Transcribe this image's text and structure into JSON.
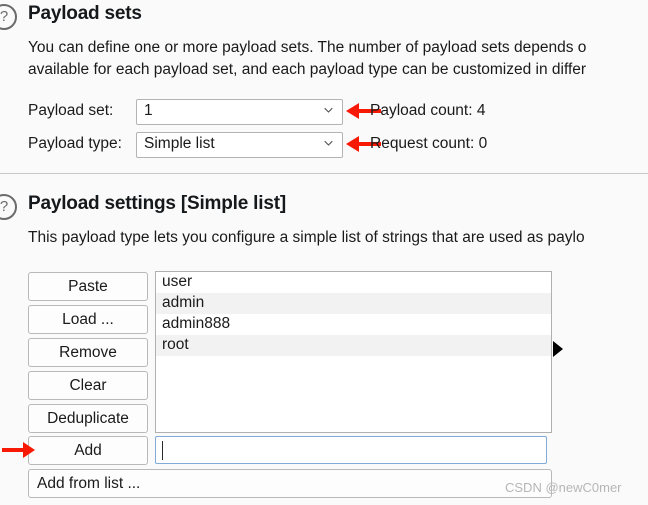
{
  "sections": [
    {
      "help_icon": "question-mark-icon",
      "title": "Payload sets",
      "desc_line1": "You can define one or more payload sets. The number of payload sets depends o",
      "desc_line2": "available for each payload set, and each payload type can be customized in differ"
    },
    {
      "help_icon": "question-mark-icon",
      "title": "Payload settings [Simple list]",
      "desc_line1": "This payload type lets you configure a simple list of strings that are used as paylo"
    }
  ],
  "payload_set": {
    "label": "Payload set:",
    "value": "1",
    "count_label": "Payload count: 4"
  },
  "payload_type": {
    "label": "Payload type:",
    "value": "Simple list",
    "count_label": "Request count: 0"
  },
  "buttons": [
    {
      "label": "Paste"
    },
    {
      "label": "Load ..."
    },
    {
      "label": "Remove"
    },
    {
      "label": "Clear"
    },
    {
      "label": "Deduplicate"
    },
    {
      "label": "Add"
    }
  ],
  "add_from_list_button": {
    "label": "Add from list ..."
  },
  "payload_list": {
    "items": [
      {
        "value": "user"
      },
      {
        "value": "admin"
      },
      {
        "value": "admin888"
      },
      {
        "value": "root"
      }
    ]
  },
  "new_payload_input": {
    "value": "",
    "placeholder": ""
  },
  "annotations": {
    "arrow_color": "#f81905",
    "arrow_payload_count": "left-arrow-icon",
    "arrow_request_count": "left-arrow-icon",
    "arrow_add_button": "right-arrow-icon"
  },
  "watermark": {
    "text": "CSDN @newC0mer"
  }
}
